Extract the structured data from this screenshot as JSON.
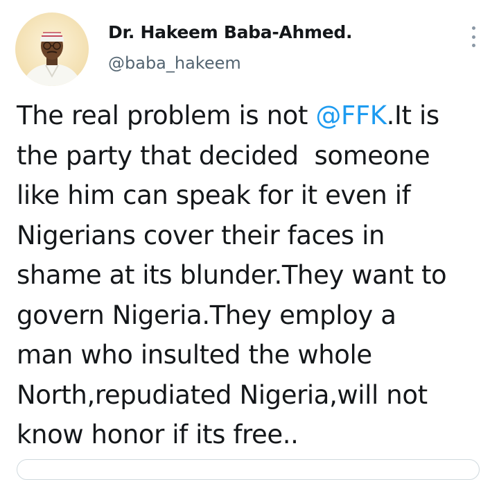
{
  "author": {
    "display_name": "Dr. Hakeem Baba-Ahmed.",
    "handle": "@baba_hakeem"
  },
  "tweet": {
    "lines": [
      {
        "before": "The real problem is not ",
        "mention": "@FFK",
        "after": ".It is"
      },
      {
        "text": "the party that decided  someone"
      },
      {
        "text": "like him can speak for it even if"
      },
      {
        "text": "Nigerians cover their faces in"
      },
      {
        "text": "shame at its blunder.They want to"
      },
      {
        "text": "govern Nigeria.They employ a"
      },
      {
        "text": "man who insulted the whole"
      },
      {
        "text": "North,repudiated Nigeria,will not"
      },
      {
        "text": "know honor if its free.."
      }
    ]
  },
  "icons": {
    "more": "more-vertical-icon"
  },
  "colors": {
    "text": "#14171a",
    "handle": "#536471",
    "mention": "#1d9bf0",
    "border": "#cfd9de"
  }
}
